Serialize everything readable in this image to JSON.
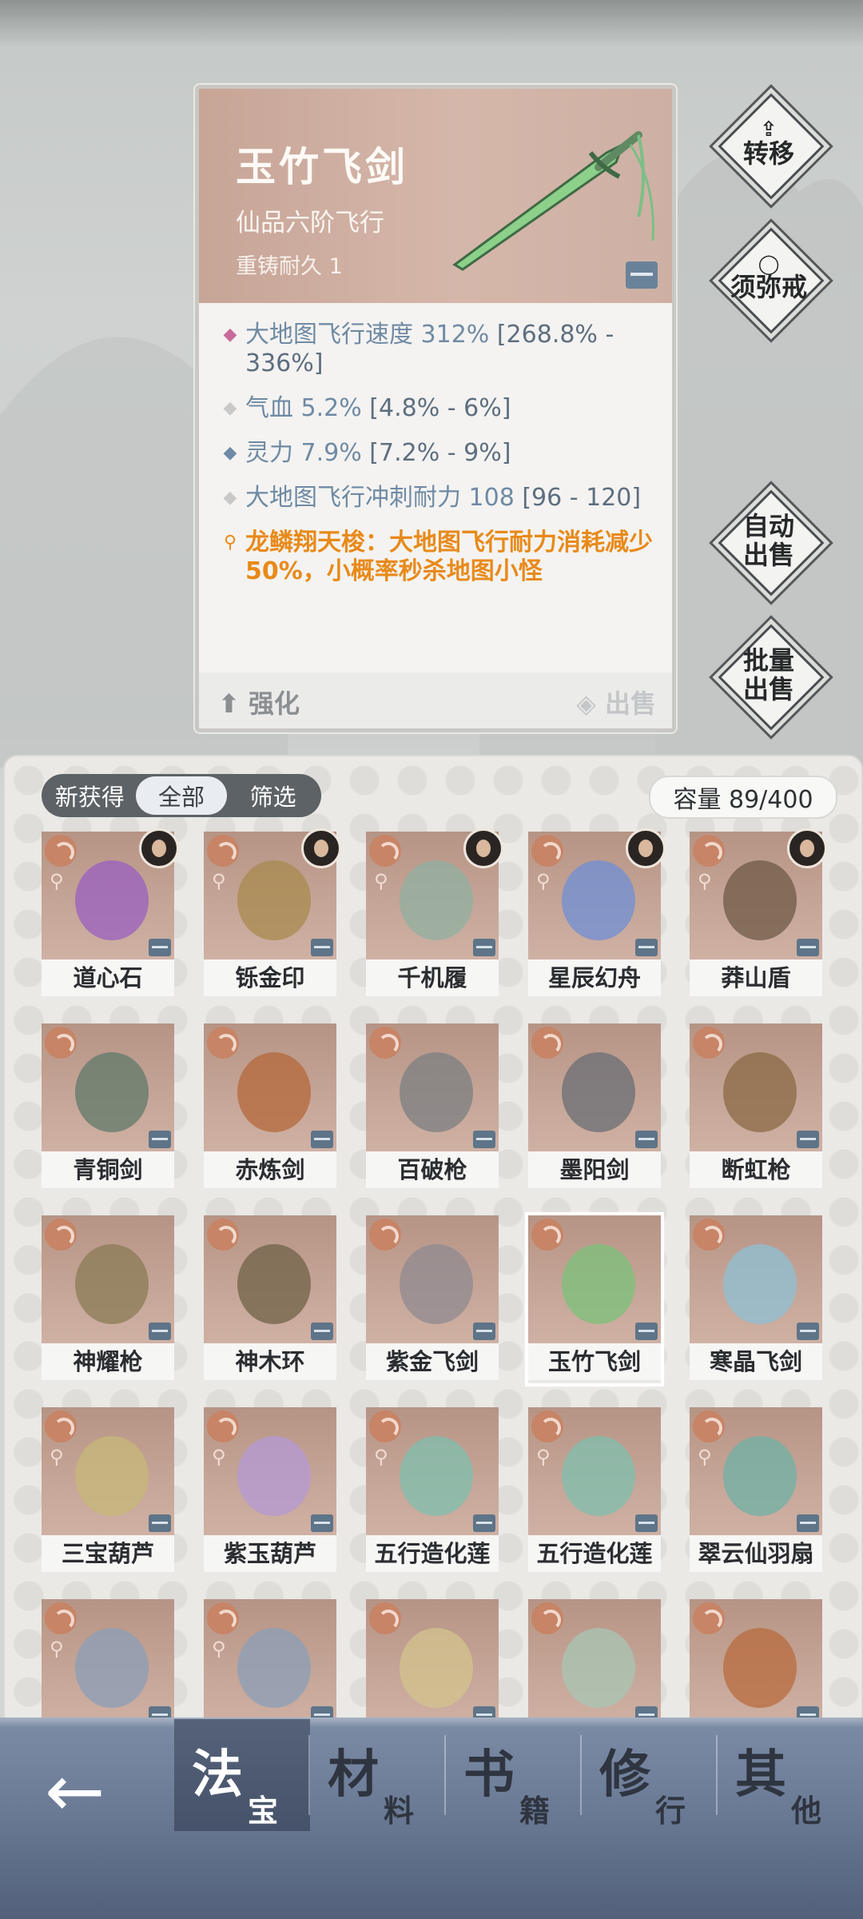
{
  "detail": {
    "name": "玉竹飞剑",
    "grade": "仙品六阶飞行",
    "recast": "重铸耐久 1",
    "stats": [
      {
        "name": "大地图飞行速度 312%",
        "range": " [268.8% - 336%]",
        "bullet": "◆",
        "bullet_color": "#c96a9a"
      },
      {
        "name": "气血 5.2%",
        "range": " [4.8% - 6%]",
        "bullet": "◆",
        "bullet_color": "#c9c9c9"
      },
      {
        "name": "灵力 7.9%",
        "range": " [7.2% - 9%]",
        "bullet": "◆",
        "bullet_color": "#6e8aa8"
      },
      {
        "name": "大地图飞行冲刺耐力 108",
        "range": " [96 - 120]",
        "bullet": "◆",
        "bullet_color": "#c9c9c9"
      }
    ],
    "set_bonus": "龙鳞翔天梭：大地图飞行耐力消耗减少50%，小概率秒杀地图小怪",
    "set_bullet": "⚲",
    "enhance_label": "强化",
    "sell_label": "出售"
  },
  "side_buttons": {
    "transfer": "转移",
    "ring": "须弥戒",
    "auto_sell_1": "自动",
    "auto_sell_2": "出售",
    "batch_sell_1": "批量",
    "batch_sell_2": "出售"
  },
  "filter_tabs": [
    "新获得",
    "全部",
    "筛选"
  ],
  "filter_active": "全部",
  "capacity": "容量 89/400",
  "items": [
    {
      "name": "道心石",
      "avatar": true,
      "color": "#9a5fc0"
    },
    {
      "name": "铄金印",
      "avatar": true,
      "color": "#a88a4e"
    },
    {
      "name": "千机履",
      "avatar": true,
      "color": "#8fb0a0"
    },
    {
      "name": "星辰幻舟",
      "avatar": true,
      "color": "#6f8fd6"
    },
    {
      "name": "莽山盾",
      "avatar": true,
      "color": "#6e5a46"
    },
    {
      "name": "青铜剑",
      "avatar": false,
      "color": "#5f7a6a"
    },
    {
      "name": "赤炼剑",
      "avatar": false,
      "color": "#b4683a"
    },
    {
      "name": "百破枪",
      "avatar": false,
      "color": "#7b7f82"
    },
    {
      "name": "墨阳剑",
      "avatar": false,
      "color": "#6a6e74"
    },
    {
      "name": "断虹枪",
      "avatar": false,
      "color": "#8a6a44"
    },
    {
      "name": "神耀枪",
      "avatar": false,
      "color": "#8a7b55"
    },
    {
      "name": "神木环",
      "avatar": false,
      "color": "#6f6248"
    },
    {
      "name": "紫金飞剑",
      "avatar": false,
      "color": "#8f8a90"
    },
    {
      "name": "玉竹飞剑",
      "avatar": false,
      "color": "#7bc27a",
      "selected": true
    },
    {
      "name": "寒晶飞剑",
      "avatar": false,
      "color": "#8ec0d6"
    },
    {
      "name": "三宝葫芦",
      "avatar": false,
      "color": "#c7b878"
    },
    {
      "name": "紫玉葫芦",
      "avatar": false,
      "color": "#b49ad6"
    },
    {
      "name": "五行造化莲",
      "avatar": false,
      "color": "#7fbfae"
    },
    {
      "name": "五行造化莲",
      "avatar": false,
      "color": "#7fbfae"
    },
    {
      "name": "翠云仙羽扇",
      "avatar": false,
      "color": "#6fb2a6"
    },
    {
      "name": "",
      "avatar": false,
      "color": "#8a9fb8"
    },
    {
      "name": "",
      "avatar": false,
      "color": "#8a9fb8"
    },
    {
      "name": "",
      "avatar": false,
      "color": "#d2c48e"
    },
    {
      "name": "",
      "avatar": false,
      "color": "#a8c6b4"
    },
    {
      "name": "",
      "avatar": false,
      "color": "#b86b3e"
    }
  ],
  "nav": {
    "back": "←",
    "tabs": [
      {
        "big": "法",
        "small": "宝"
      },
      {
        "big": "材",
        "small": "料"
      },
      {
        "big": "书",
        "small": "籍"
      },
      {
        "big": "修",
        "small": "行"
      },
      {
        "big": "其",
        "small": "他"
      }
    ],
    "active_index": 0
  }
}
